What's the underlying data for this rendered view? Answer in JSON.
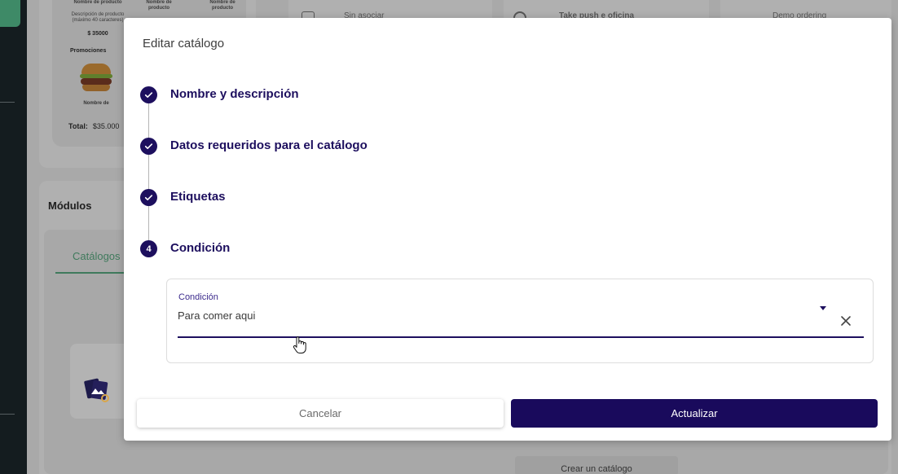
{
  "background": {
    "products": {
      "col1_label": "Nombre de producto",
      "col2_label": "Nombre de producto",
      "col3_label": "Nombre de producto",
      "description": "Descripción de producto (máximo 40 caracteres)",
      "price": "$ 35000",
      "promotions_label": "Promociones",
      "promo_name": "Nombre de",
      "total_label": "Total:",
      "total_value": "$35.000"
    },
    "top_cards": {
      "card2_text": "Sin asociar",
      "card3_text": "Take push e oficina",
      "card4_text": "Demo ordering"
    },
    "modules_title": "Módulos",
    "tab_catalogs": "Catálogos",
    "create_catalog_button": "Crear un catálogo"
  },
  "modal": {
    "title": "Editar catálogo",
    "steps": [
      {
        "label": "Nombre y descripción",
        "state": "done"
      },
      {
        "label": "Datos requeridos para el catálogo",
        "state": "done"
      },
      {
        "label": "Etiquetas",
        "state": "done"
      },
      {
        "label": "Condición",
        "state": "active",
        "number": "4"
      }
    ],
    "condition_field": {
      "label": "Condición",
      "value": "Para comer aqui",
      "icons": [
        "dropdown-arrow-icon",
        "clear-icon"
      ]
    },
    "buttons": {
      "cancel": "Cancelar",
      "update": "Actualizar"
    }
  },
  "colors": {
    "primary": "#190a5c",
    "step_text": "#1d0f5e",
    "accent_green": "#3f7a5c",
    "overlay_bg": "#a9a9a9"
  }
}
